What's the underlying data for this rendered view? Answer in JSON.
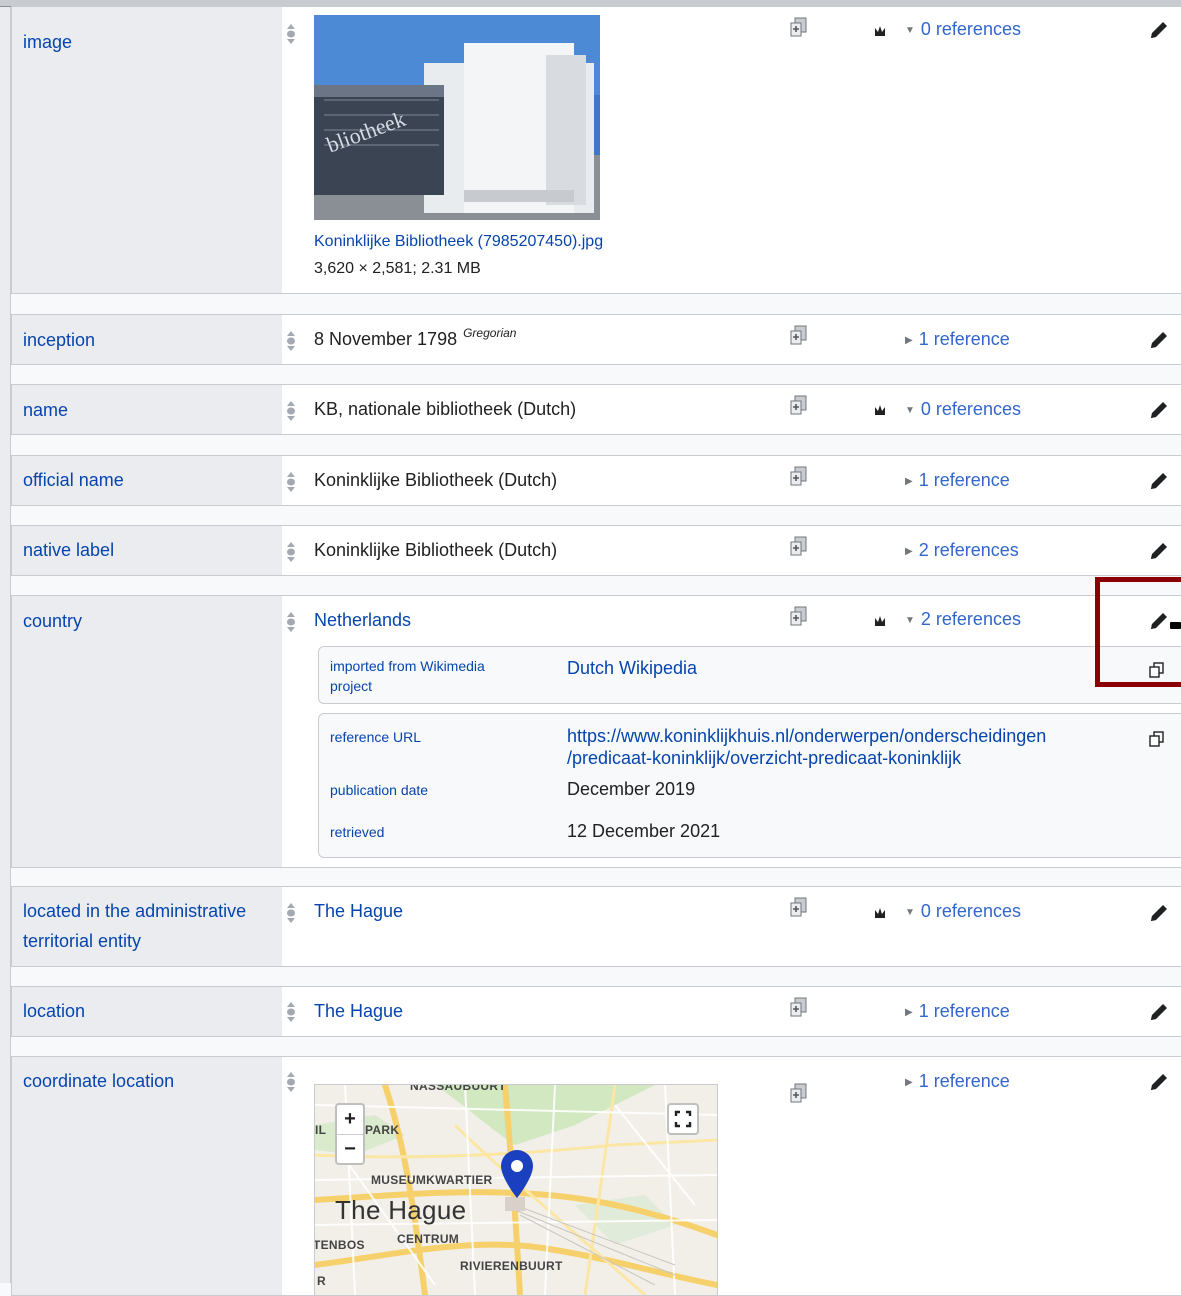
{
  "statements": [
    {
      "property": "image",
      "file_name": "Koninklijke Bibliotheek (7985207450).jpg",
      "file_meta": "3,620 × 2,581; 2.31 MB",
      "references": "0 references",
      "image_text": "bliotheek"
    },
    {
      "property": "inception",
      "value": "8 November 1798",
      "calendar": "Gregorian",
      "references": "1 reference"
    },
    {
      "property": "name",
      "value": "KB, nationale bibliotheek (Dutch)",
      "references": "0 references"
    },
    {
      "property": "official name",
      "value": "Koninklijke Bibliotheek (Dutch)",
      "references": "1 reference"
    },
    {
      "property": "native label",
      "value": "Koninklijke Bibliotheek (Dutch)",
      "references": "2 references"
    },
    {
      "property": "country",
      "value": "Netherlands",
      "references": "2 references",
      "reference_blocks": [
        {
          "rows": [
            {
              "prop": "imported from Wikimedia project",
              "val": "Dutch Wikipedia"
            }
          ]
        },
        {
          "rows": [
            {
              "prop": "reference URL",
              "val_line1": "https://www.koninklijkhuis.nl/onderwerpen/onderscheidingen",
              "val_line2": "/predicaat-koninklijk/overzicht-predicaat-koninklijk"
            },
            {
              "prop": "publication date",
              "val": "December 2019"
            },
            {
              "prop": "retrieved",
              "val": "12 December 2021"
            }
          ]
        }
      ]
    },
    {
      "property": "located in the administrative territorial entity",
      "value": "The Hague",
      "references": "0 references"
    },
    {
      "property": "location",
      "value": "The Hague",
      "references": "1 reference"
    },
    {
      "property": "coordinate location",
      "references": "1 reference",
      "map": {
        "zoom_in": "+",
        "zoom_out": "−",
        "city": "The Hague",
        "labels": [
          "NASSAUBUURT",
          "PARK",
          "IL",
          "MUSEUMKWARTIER",
          "CENTRUM",
          "TENBOS",
          "RIVIERENBUURT",
          "R"
        ]
      }
    }
  ],
  "icons": {
    "rank": "rank-normal-icon",
    "qualifier": "add-qualifier-icon",
    "deprecated_rank": "rank-preferred-icon",
    "edit": "pencil-icon",
    "copy": "copy-icon",
    "fullscreen": "fullscreen-icon",
    "pin": "map-pin-icon"
  },
  "colors": {
    "link": "#0645ad",
    "refs": "#3366cc",
    "highlight": "#8b0000",
    "pin": "#1a3fbf"
  }
}
